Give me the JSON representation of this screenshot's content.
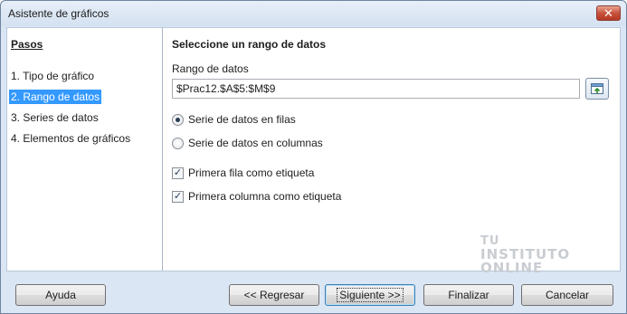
{
  "window": {
    "title": "Asistente de gráficos",
    "close_glyph": "✕"
  },
  "steps": {
    "heading": "Pasos",
    "items": [
      {
        "label": "1. Tipo de gráfico",
        "active": false
      },
      {
        "label": "2. Rango de datos",
        "active": true
      },
      {
        "label": "3. Series de datos",
        "active": false
      },
      {
        "label": "4. Elementos de gráficos",
        "active": false
      }
    ]
  },
  "main": {
    "section_title": "Seleccione un rango de datos",
    "range_label": "Rango de datos",
    "range_value": "$Prac12.$A$5:$M$9",
    "options": {
      "rows": {
        "label": "Serie de datos en filas",
        "checked": true
      },
      "columns": {
        "label": "Serie de datos en columnas",
        "checked": false
      },
      "first_row_label": {
        "label": "Primera fila como etiqueta",
        "checked": true
      },
      "first_col_label": {
        "label": "Primera columna como etiqueta",
        "checked": true
      }
    }
  },
  "watermark": {
    "line1": "TU",
    "line2": "INSTITUTO",
    "line3": "ONLINE"
  },
  "buttons": {
    "help": "Ayuda",
    "back": "<< Regresar",
    "next": "Siguiente >>",
    "finish": "Finalizar",
    "cancel": "Cancelar"
  },
  "colors": {
    "selection": "#3399ff",
    "frame": "#dbe6f4"
  },
  "icons": {
    "shrink": "shrink-range-icon",
    "close": "close-icon"
  }
}
